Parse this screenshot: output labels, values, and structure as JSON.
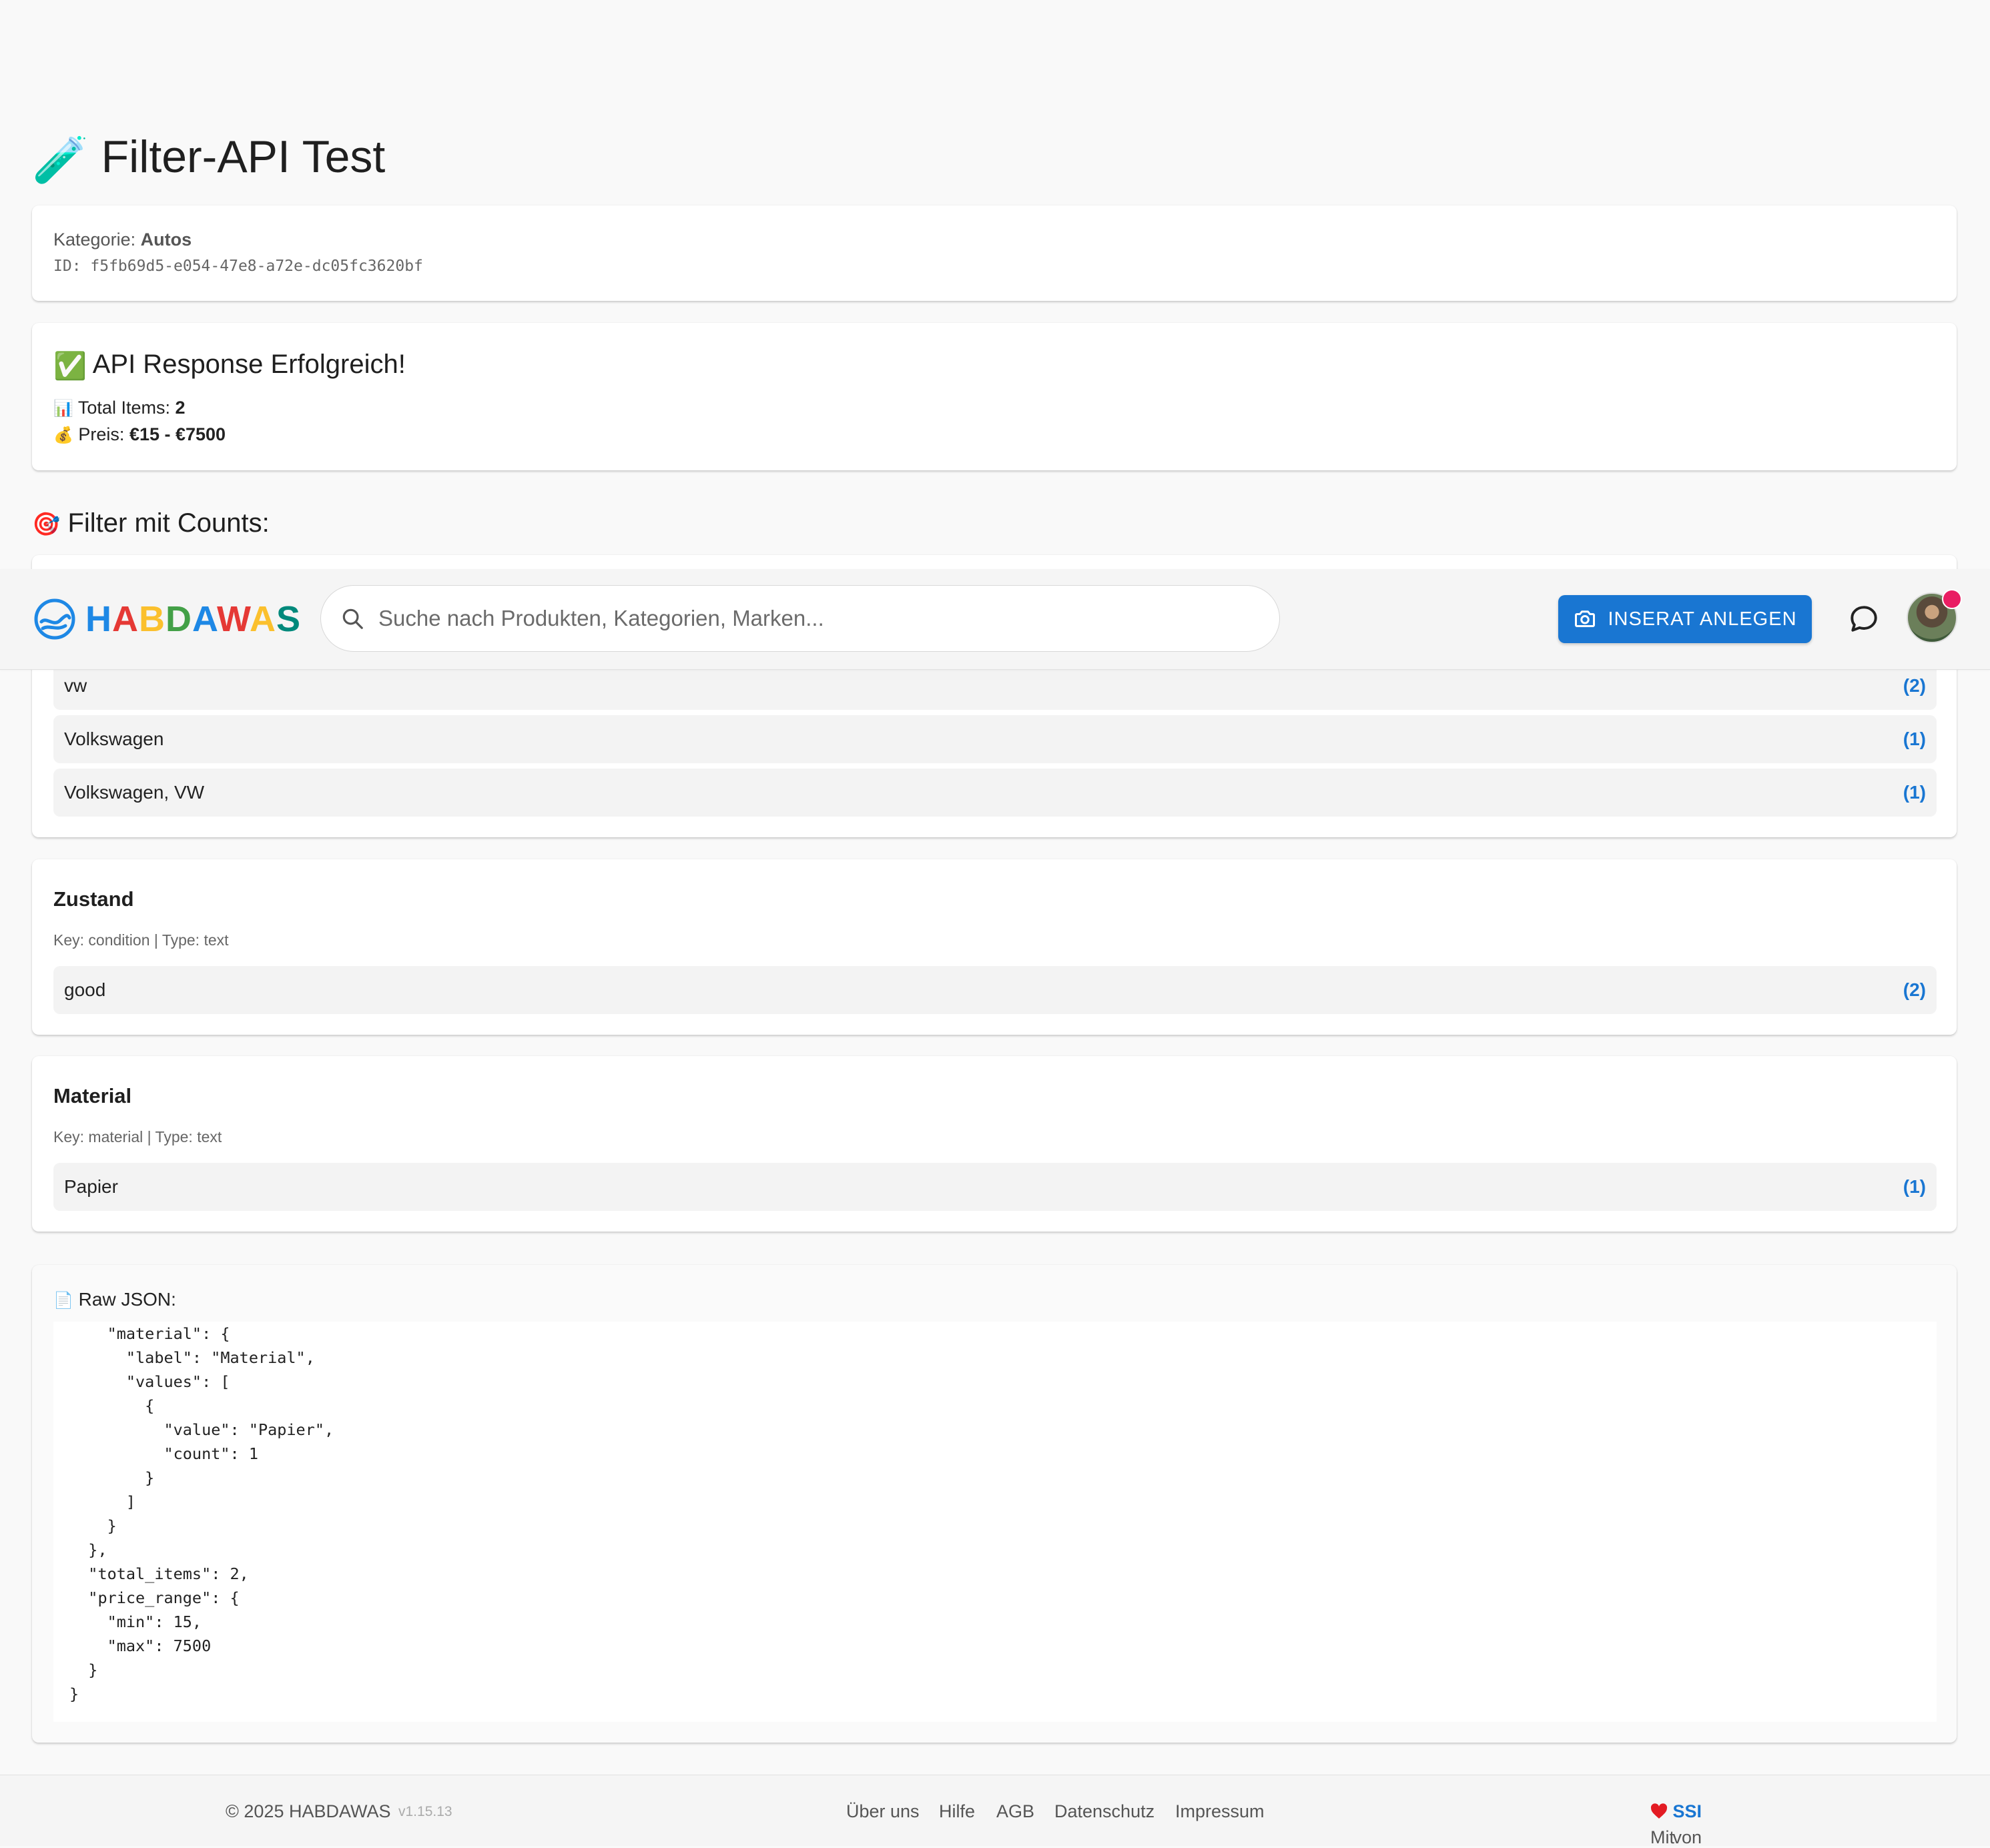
{
  "page": {
    "title_emoji": "🧪",
    "title": "Filter-API Test"
  },
  "category_card": {
    "label": "Kategorie:",
    "name": "Autos",
    "id_line": "ID: f5fb69d5-e054-47e8-a72e-dc05fc3620bf"
  },
  "response_card": {
    "emoji": "✅",
    "title": "API Response Erfolgreich!",
    "total_emoji": "📊",
    "total_label": "Total Items:",
    "total_value": "2",
    "price_emoji": "💰",
    "price_label": "Preis:",
    "price_value": "€15 - €7500"
  },
  "filters_heading": {
    "emoji": "🎯",
    "text": "Filter mit Counts:"
  },
  "brand_rows": [
    {
      "value": "vw",
      "count": "(2)"
    },
    {
      "value": "Volkswagen",
      "count": "(1)"
    },
    {
      "value": "Volkswagen, VW",
      "count": "(1)"
    }
  ],
  "condition_filter": {
    "title": "Zustand",
    "meta": "Key: condition | Type: text",
    "rows": [
      {
        "value": "good",
        "count": "(2)"
      }
    ]
  },
  "material_filter": {
    "title": "Material",
    "meta": "Key: material | Type: text",
    "rows": [
      {
        "value": "Papier",
        "count": "(1)"
      }
    ]
  },
  "raw_json": {
    "emoji": "📄",
    "label": "Raw JSON:",
    "content": "    \"material\": {\n      \"label\": \"Material\",\n      \"values\": [\n        {\n          \"value\": \"Papier\",\n          \"count\": 1\n        }\n      ]\n    }\n  },\n  \"total_items\": 2,\n  \"price_range\": {\n    \"min\": 15,\n    \"max\": 7500\n  }\n}"
  },
  "navbar": {
    "logo_letters": [
      {
        "ch": "H",
        "color": "#1e88e5"
      },
      {
        "ch": "A",
        "color": "#e53935"
      },
      {
        "ch": "B",
        "color": "#fbc02d"
      },
      {
        "ch": "D",
        "color": "#43a047"
      },
      {
        "ch": "A",
        "color": "#1e88e5"
      },
      {
        "ch": "W",
        "color": "#e53935"
      },
      {
        "ch": "A",
        "color": "#fbc02d"
      },
      {
        "ch": "S",
        "color": "#00897b"
      }
    ],
    "search_placeholder": "Suche nach Produkten, Kategorien, Marken...",
    "create_button": "INSERAT ANLEGEN",
    "accent": "#1976d2",
    "badge_color": "#e91e63"
  },
  "footer": {
    "copyright": "© 2025 HABDAWAS",
    "version": "v1.15.13",
    "links": [
      "Über uns",
      "Hilfe",
      "AGB",
      "Datenschutz",
      "Impressum"
    ],
    "made_prefix": "Mit",
    "made_mid": "von",
    "made_by": "SSI"
  }
}
